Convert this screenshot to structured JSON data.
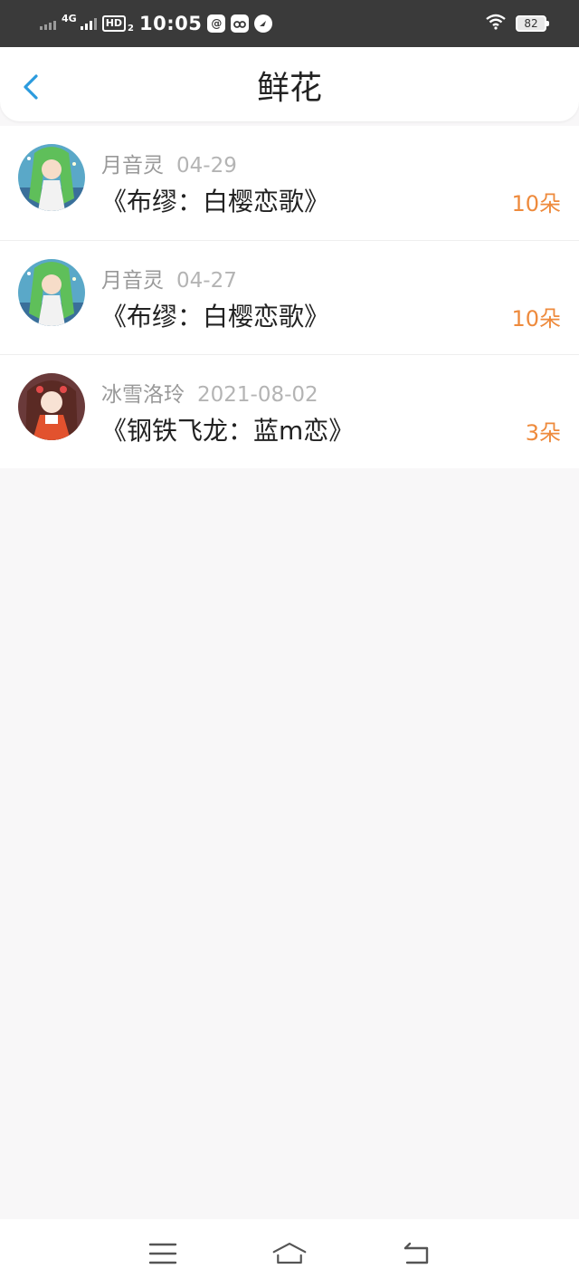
{
  "status_bar": {
    "network": "4G",
    "hd_label": "HD",
    "hd_sub": "2",
    "time": "10:05",
    "battery": "82"
  },
  "header": {
    "title": "鲜花"
  },
  "gifts": [
    {
      "user": "月音灵",
      "date": "04-29",
      "title": "《布缪：白樱恋歌》",
      "count": "10朵"
    },
    {
      "user": "月音灵",
      "date": "04-27",
      "title": "《布缪：白樱恋歌》",
      "count": "10朵"
    },
    {
      "user": "冰雪洛玲",
      "date": "2021-08-02",
      "title": "《钢铁飞龙：蓝m恋》",
      "count": "3朵"
    }
  ],
  "colors": {
    "accent": "#2b9bde",
    "count": "#ee8a3c"
  }
}
